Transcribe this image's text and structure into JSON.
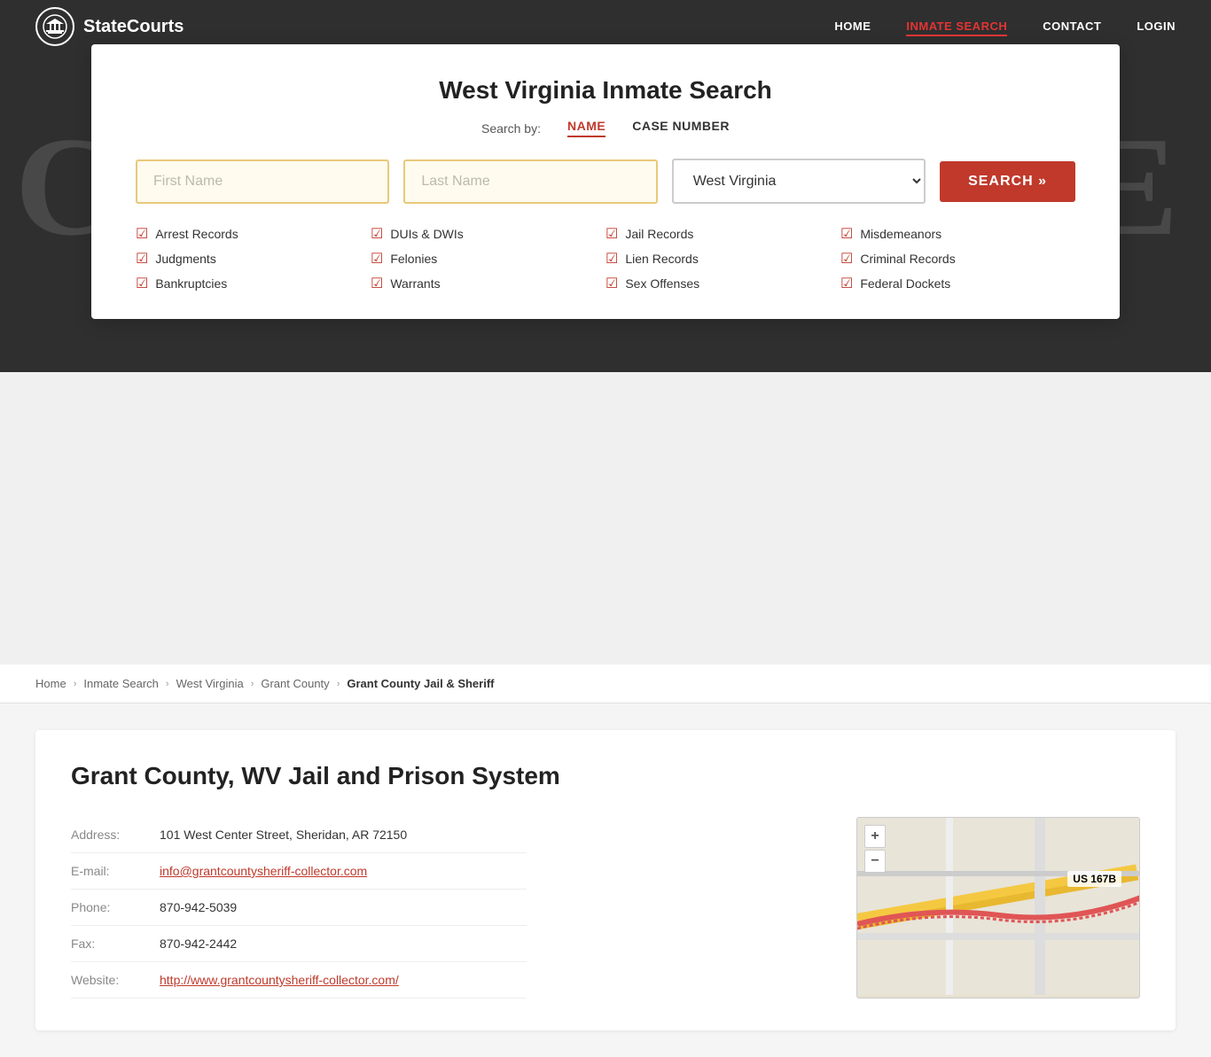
{
  "navbar": {
    "logo_text": "StateCourts",
    "logo_icon": "🏛",
    "links": [
      {
        "label": "HOME",
        "active": false
      },
      {
        "label": "INMATE SEARCH",
        "active": true
      },
      {
        "label": "CONTACT",
        "active": false
      },
      {
        "label": "LOGIN",
        "active": false
      }
    ]
  },
  "hero_text": "COURTHOUSE",
  "search_card": {
    "title": "West Virginia Inmate Search",
    "tab_label": "Search by:",
    "tabs": [
      {
        "label": "NAME",
        "active": true
      },
      {
        "label": "CASE NUMBER",
        "active": false
      }
    ],
    "first_name_placeholder": "First Name",
    "last_name_placeholder": "Last Name",
    "state_default": "West Virginia",
    "search_btn_label": "SEARCH »",
    "checklist": [
      [
        {
          "label": "Arrest Records"
        },
        {
          "label": "Judgments"
        },
        {
          "label": "Bankruptcies"
        }
      ],
      [
        {
          "label": "DUIs & DWIs"
        },
        {
          "label": "Felonies"
        },
        {
          "label": "Warrants"
        }
      ],
      [
        {
          "label": "Jail Records"
        },
        {
          "label": "Lien Records"
        },
        {
          "label": "Sex Offenses"
        }
      ],
      [
        {
          "label": "Misdemeanors"
        },
        {
          "label": "Criminal Records"
        },
        {
          "label": "Federal Dockets"
        }
      ]
    ]
  },
  "breadcrumb": {
    "items": [
      {
        "label": "Home",
        "link": true
      },
      {
        "label": "Inmate Search",
        "link": true
      },
      {
        "label": "West Virginia",
        "link": true
      },
      {
        "label": "Grant County",
        "link": true
      },
      {
        "label": "Grant County Jail & Sheriff",
        "link": false
      }
    ]
  },
  "main": {
    "title": "Grant County, WV Jail and Prison System",
    "fields": [
      {
        "label": "Address:",
        "value": "101 West Center Street, Sheridan, AR 72150",
        "link": false
      },
      {
        "label": "E-mail:",
        "value": "info@grantcountysheriff-collector.com",
        "link": true
      },
      {
        "label": "Phone:",
        "value": "870-942-5039",
        "link": false
      },
      {
        "label": "Fax:",
        "value": "870-942-2442",
        "link": false
      },
      {
        "label": "Website:",
        "value": "http://www.grantcountysheriff-collector.com/",
        "link": true
      }
    ],
    "map": {
      "plus": "+",
      "minus": "−",
      "road_label": "US 167B"
    }
  }
}
